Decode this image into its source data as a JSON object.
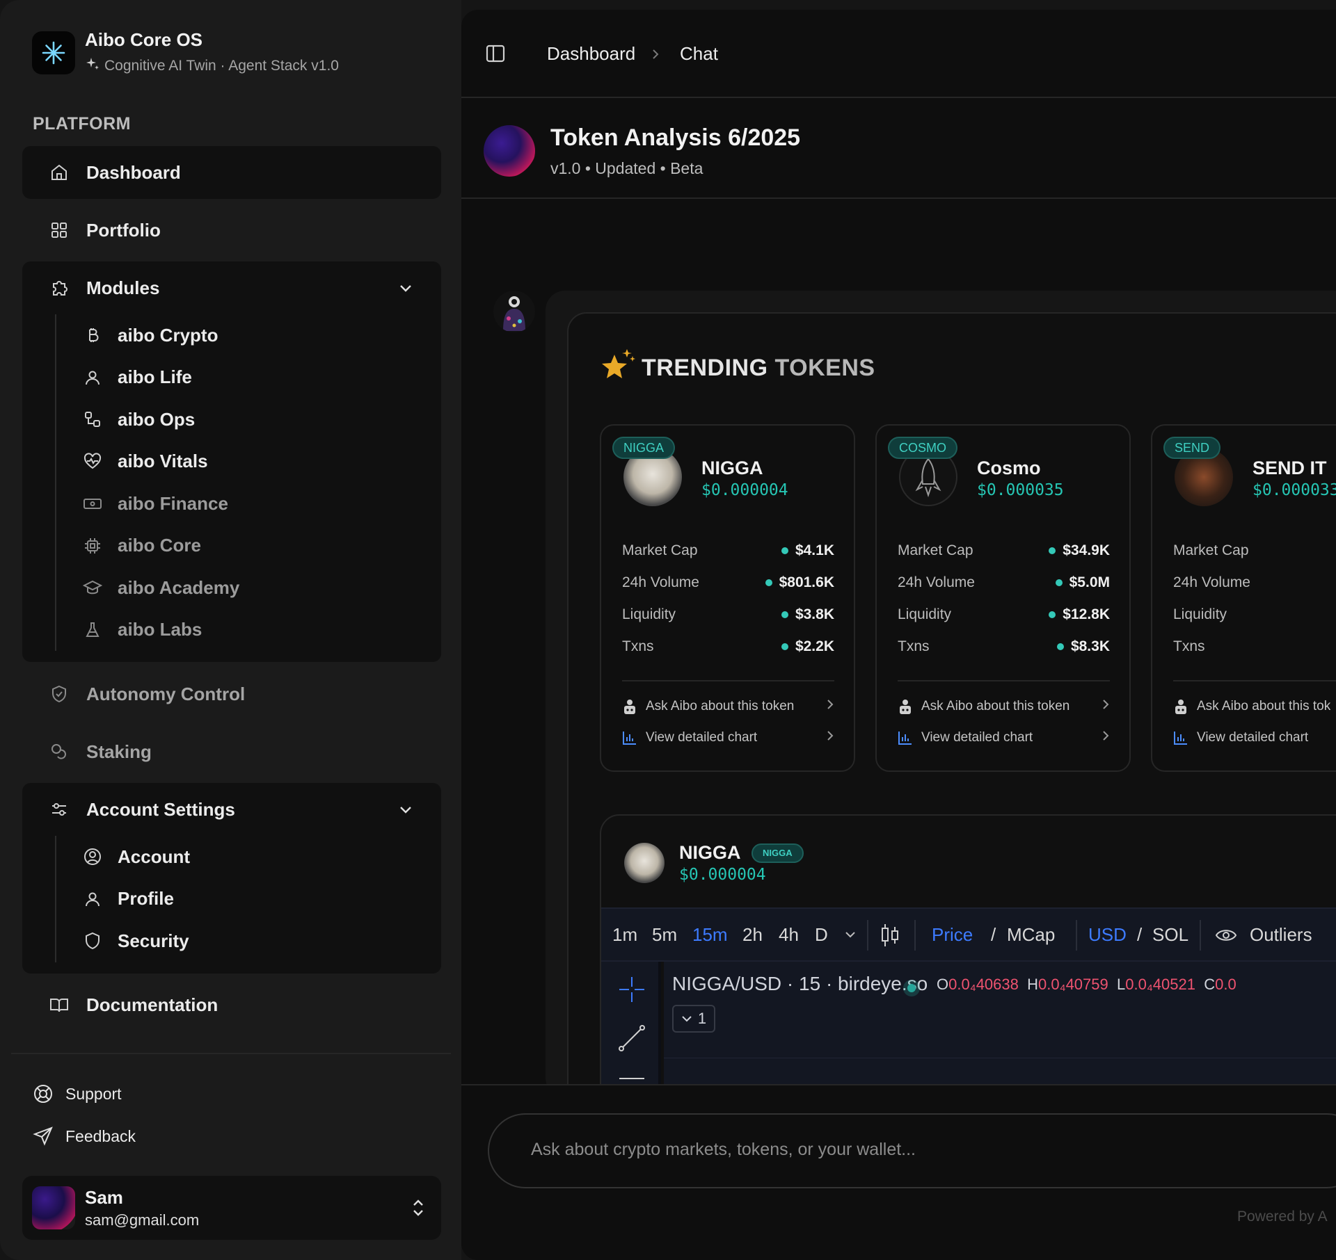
{
  "brand": {
    "title": "Aibo Core OS",
    "subtitle": "Cognitive AI Twin · Agent Stack v1.0"
  },
  "sidebar": {
    "section_label": "PLATFORM",
    "dashboard": "Dashboard",
    "portfolio": "Portfolio",
    "modules": {
      "label": "Modules",
      "items": [
        "aibo Crypto",
        "aibo Life",
        "aibo Ops",
        "aibo Vitals",
        "aibo Finance",
        "aibo Core",
        "aibo Academy",
        "aibo Labs"
      ]
    },
    "autonomy": "Autonomy Control",
    "staking": "Staking",
    "account_settings": {
      "label": "Account Settings",
      "items": [
        "Account",
        "Profile",
        "Security"
      ]
    },
    "documentation": "Documentation",
    "support": "Support",
    "feedback": "Feedback"
  },
  "user": {
    "name": "Sam",
    "email": "sam@gmail.com"
  },
  "header": {
    "breadcrumb": [
      "Dashboard",
      "Chat"
    ]
  },
  "page": {
    "title": "Token Analysis 6/2025",
    "meta": "v1.0  • Updated  • Beta"
  },
  "trending": {
    "title_a": "TRENDING",
    "title_b": "TOKENS",
    "stat_labels": [
      "Market Cap",
      "24h Volume",
      "Liquidity",
      "Txns"
    ],
    "ask_label": "Ask Aibo about this token",
    "ask_label_short": "Ask Aibo about this tok",
    "chart_label": "View detailed chart",
    "tokens": [
      {
        "tag": "NIGGA",
        "name": "NIGGA",
        "price": "$0.000004",
        "stats": [
          "$4.1K",
          "$801.6K",
          "$3.8K",
          "$2.2K"
        ]
      },
      {
        "tag": "COSMO",
        "name": "Cosmo",
        "price": "$0.000035",
        "stats": [
          "$34.9K",
          "$5.0M",
          "$12.8K",
          "$8.3K"
        ]
      },
      {
        "tag": "SEND",
        "name": "SEND IT",
        "price": "$0.000033"
      }
    ]
  },
  "detail": {
    "name": "NIGGA",
    "tag": "NIGGA",
    "price": "$0.000004",
    "intervals": [
      "1m",
      "5m",
      "15m",
      "2h",
      "4h",
      "D"
    ],
    "active_interval": "15m",
    "price_label": "Price",
    "mcap_label": "MCap",
    "usd_label": "USD",
    "sol_label": "SOL",
    "slash": "/",
    "outliers": "Outliers",
    "symbol": "NIGGA/USD · 15 · birdeye.so",
    "ohlc": {
      "o_label": "O",
      "o": "0.0₄40638",
      "h_label": "H",
      "h": "0.0₄40759",
      "l_label": "L",
      "l": "0.0₄40521",
      "c_label": "C",
      "c": "0.0"
    },
    "badge": "1"
  },
  "composer": {
    "placeholder": "Ask about crypto markets, tokens, or your wallet...",
    "powered": "Powered by A"
  },
  "colors": {
    "accent_teal": "#26c6b4",
    "tv_blue": "#3d7bff",
    "ohlc_red": "#ef5370"
  }
}
